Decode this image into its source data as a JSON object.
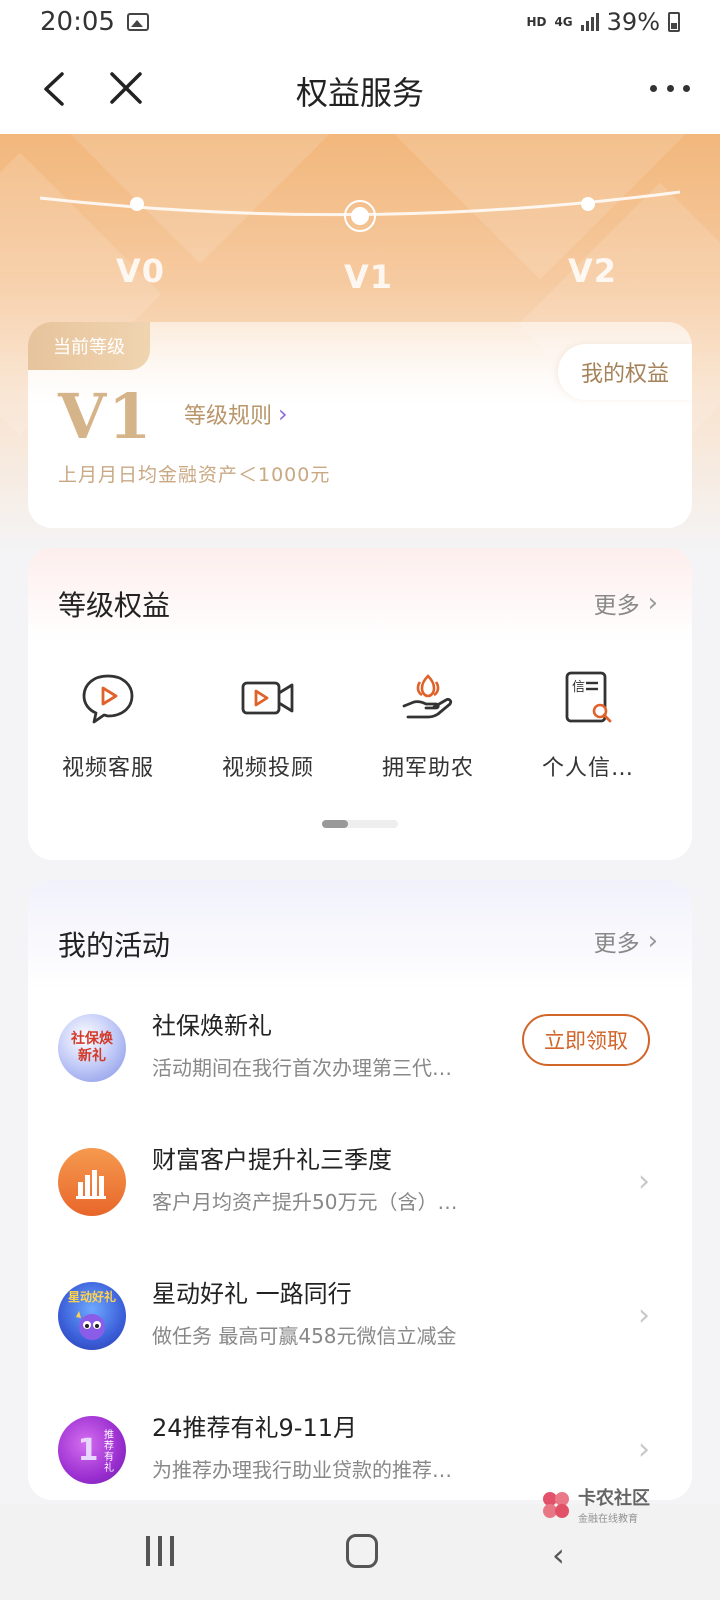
{
  "status_bar": {
    "time": "20:05",
    "hd": "HD",
    "network": "4G",
    "battery": "39%"
  },
  "nav": {
    "title": "权益服务"
  },
  "levels": {
    "items": [
      "V0",
      "V1",
      "V2"
    ],
    "current": "V1"
  },
  "level_card": {
    "badge": "当前等级",
    "my_rights": "我的权益",
    "level": "V1",
    "rules": "等级规则",
    "desc": "上月月日均金融资产＜1000元"
  },
  "rights": {
    "title": "等级权益",
    "more": "更多",
    "items": [
      {
        "label": "视频客服",
        "icon": "chat-play-icon"
      },
      {
        "label": "视频投顾",
        "icon": "video-camera-icon"
      },
      {
        "label": "拥军助农",
        "icon": "hand-flower-icon"
      },
      {
        "label": "个人信…",
        "icon": "credit-search-icon"
      }
    ]
  },
  "activities": {
    "title": "我的活动",
    "more": "更多",
    "items": [
      {
        "title": "社保焕新礼",
        "desc": "活动期间在我行首次办理第三代…",
        "action": "立即领取",
        "avatar_text": "社保焕新礼"
      },
      {
        "title": "财富客户提升礼三季度",
        "desc": "客户月均资产提升50万元（含）…"
      },
      {
        "title": "星动好礼 一路同行",
        "desc": "做任务 最高可赢458元微信立减金",
        "avatar_text": "星动好礼"
      },
      {
        "title": "24推荐有礼9-11月",
        "desc": "为推荐办理我行助业贷款的推荐…",
        "avatar_text": "推荐有礼"
      }
    ]
  },
  "watermark": {
    "main": "卡农社区",
    "sub": "金融在线教育"
  },
  "colors": {
    "accent": "#d2652a",
    "gold": "#d6b48a",
    "hero_top": "#f2b77c"
  }
}
